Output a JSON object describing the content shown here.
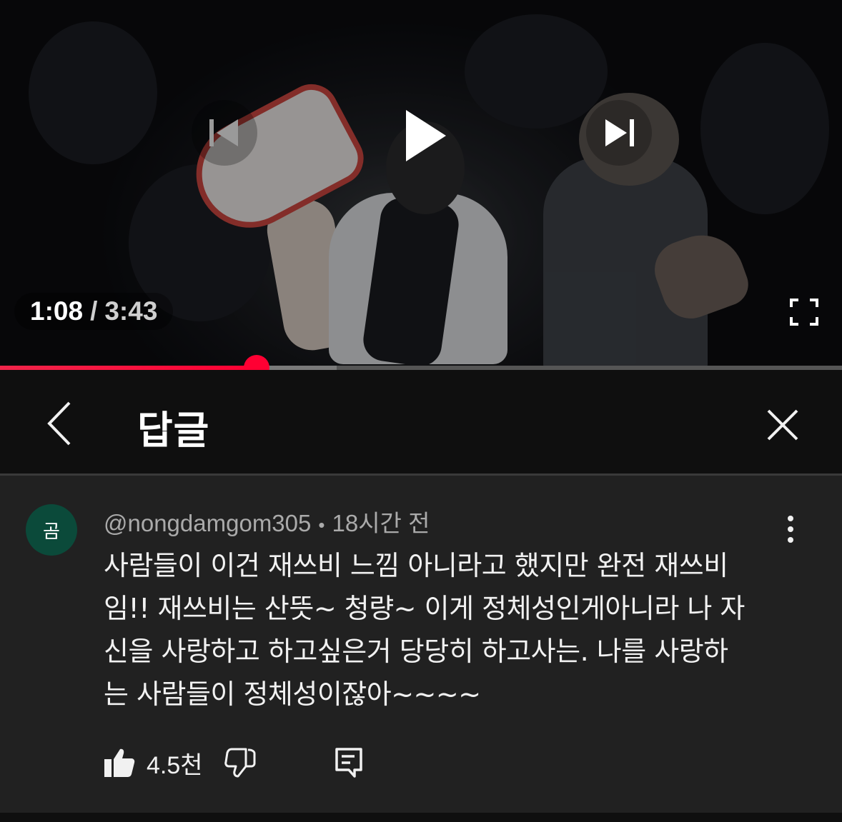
{
  "player": {
    "current_time": "1:08",
    "separator": "/",
    "total_time": "3:43",
    "progress_played": 0.305,
    "progress_buffered": 0.4,
    "accent_color": "#ff0033"
  },
  "header": {
    "title": "답글",
    "back_icon": "chevron-left-icon",
    "close_icon": "close-icon"
  },
  "comment": {
    "avatar_text": "곰",
    "avatar_color": "#0b4a3a",
    "author": "@nongdamgom305",
    "time_ago": "18시간 전",
    "text": "사람들이 이건 재쓰비 느낌 아니라고 했지만 완전 재쓰비\n임!! 재쓰비는 산뜻~ 청량~ 이게 정체성인게아니라 나 자\n신을 사랑하고 하고싶은거 당당히 하고사는. 나를 사랑하\n는 사람들이 정체성이잖아~~~~",
    "like_count": "4.5천"
  }
}
